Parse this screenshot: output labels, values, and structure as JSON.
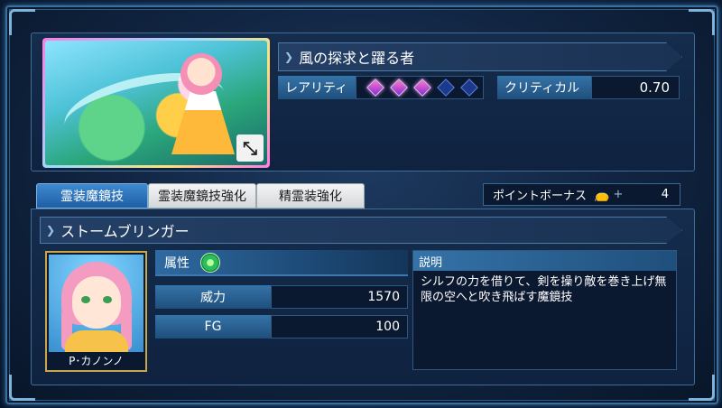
{
  "card": {
    "title": "風の探求と躍る者",
    "rarity_label": "レアリティ",
    "rarity_gems": [
      "on",
      "on",
      "on",
      "off",
      "off"
    ],
    "critical_label": "クリティカル",
    "critical_value": "0.70",
    "expand_icon": "expand-arrows-icon"
  },
  "tabs": [
    {
      "label": "霊装魔鏡技",
      "active": true
    },
    {
      "label": "霊装魔鏡技強化",
      "active": false
    },
    {
      "label": "精霊装強化",
      "active": false
    }
  ],
  "point_bonus": {
    "label": "ポイントボーナス",
    "plus": "+",
    "value": "4"
  },
  "skill": {
    "name": "ストームブリンガー",
    "attribute_label": "属性",
    "attribute_icon": "wind-attribute-icon",
    "power_label": "威力",
    "power_value": "1570",
    "fg_label": "FG",
    "fg_value": "100",
    "description_label": "説明",
    "description_text": "シルフの力を借りて、剣を操り敵を巻き上げ無限の空へと吹き飛ばす魔鏡技"
  },
  "character": {
    "name": "P･カノンノ"
  },
  "colors": {
    "accent": "#3573a8",
    "frame": "#3b6f9c",
    "gem_on": "#ff7ac8",
    "gem_off": "#1c3a8c"
  }
}
